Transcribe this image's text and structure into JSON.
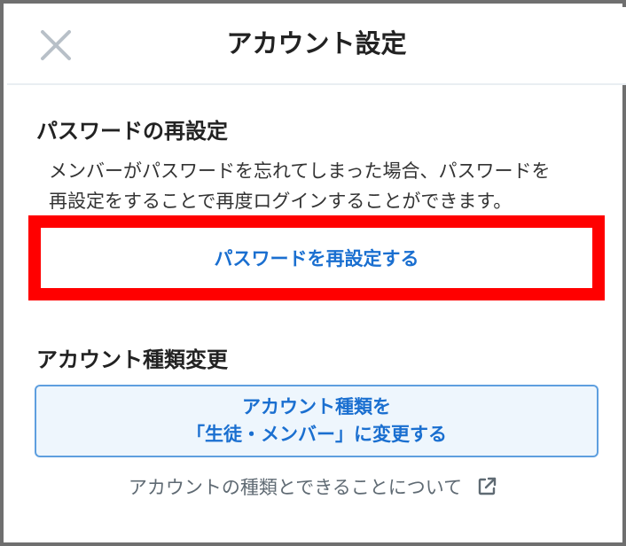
{
  "header": {
    "title": "アカウント設定",
    "close_icon": "close-icon"
  },
  "password_reset": {
    "section_title": "パスワードの再設定",
    "description_line1": "メンバーがパスワードを忘れてしまった場合、パスワードを",
    "description_line2": "再設定をすることで再度ログインすることができます。",
    "button_label": "パスワードを再設定する",
    "highlight_color": "#ff0000"
  },
  "account_type": {
    "section_title": "アカウント種類変更",
    "button_line1": "アカウント種類を",
    "button_line2": "「生徒・メンバー」に変更する",
    "link_label": "アカウントの種類とできることについて",
    "link_icon": "external-link-icon"
  },
  "colors": {
    "accent": "#1a6fd0",
    "button_bg": "#eef6fd",
    "button_border": "#5e9fdf",
    "muted_text": "#5f6a73"
  }
}
